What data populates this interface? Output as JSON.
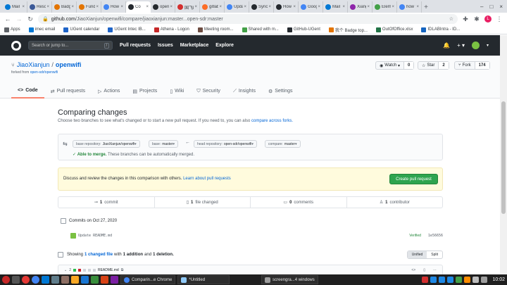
{
  "browser": {
    "tabs": [
      {
        "label": "Mail",
        "color": "#0078d4"
      },
      {
        "label": "Resou",
        "color": "#3b5998"
      },
      {
        "label": "Badge",
        "color": "#e37400"
      },
      {
        "label": "Fundi",
        "color": "#e37400"
      },
      {
        "label": "How t",
        "color": "#4285f4"
      },
      {
        "label": "Co",
        "color": "#24292e",
        "active": true
      },
      {
        "label": "open",
        "color": "#24292e"
      },
      {
        "label": "国飞E",
        "color": "#d32f2f"
      },
      {
        "label": "gitlab",
        "color": "#fc6d26"
      },
      {
        "label": "Upda",
        "color": "#4285f4"
      },
      {
        "label": "Syncii",
        "color": "#24292e"
      },
      {
        "label": "How t",
        "color": "#24292e"
      },
      {
        "label": "Goog",
        "color": "#4285f4"
      },
      {
        "label": "Mail",
        "color": "#0078d4"
      },
      {
        "label": "Xiang",
        "color": "#8e24aa"
      },
      {
        "label": "Eleme",
        "color": "#43a047"
      },
      {
        "label": "how t",
        "color": "#4285f4"
      }
    ],
    "url_host": "github.com",
    "url_path": "/JiaoXianjun/openwifi/compare/jiaoxianjun:master...open-sdr:master",
    "profile_initial": "L",
    "bookmarks": [
      {
        "label": "Apps",
        "color": "#5f6368"
      },
      {
        "label": "imec email",
        "color": "#0078d4"
      },
      {
        "label": "UGent calendar",
        "color": "#1e64c8"
      },
      {
        "label": "UGent Intec IB...",
        "color": "#1e64c8"
      },
      {
        "label": "Athena - Logon",
        "color": "#c62828"
      },
      {
        "label": "Meeting room...",
        "color": "#6d4c41"
      },
      {
        "label": "Shared with m...",
        "color": "#43a047"
      },
      {
        "label": "GitHub-UGent",
        "color": "#24292e"
      },
      {
        "label": "我个 Badge top...",
        "color": "#e37400"
      },
      {
        "label": "OutOfOffice.xlsx",
        "color": "#217346"
      },
      {
        "label": "IDLABIntra - ID...",
        "color": "#1565c0"
      }
    ]
  },
  "github": {
    "search_placeholder": "Search or jump to...",
    "search_key": "/",
    "nav": [
      "Pull requests",
      "Issues",
      "Marketplace",
      "Explore"
    ]
  },
  "repo": {
    "owner": "JiaoXianjun",
    "name": "openwifi",
    "forked_prefix": "forked from",
    "forked_from": "open-sdr/openwifi",
    "watch_label": "Watch",
    "watch_count": "0",
    "star_label": "Star",
    "star_count": "2",
    "fork_label": "Fork",
    "fork_count": "174",
    "tabs": [
      "Code",
      "Pull requests",
      "Actions",
      "Projects",
      "Wiki",
      "Security",
      "Insights",
      "Settings"
    ]
  },
  "compare": {
    "title": "Comparing changes",
    "subtitle": "Choose two branches to see what's changed or to start a new pull request. If you need to, you can also",
    "subtitle_link": "compare across forks.",
    "base_repo_label": "base repository:",
    "base_repo": "JiaoXianjun/openwifi",
    "base_label": "base:",
    "base": "master",
    "head_repo_label": "head repository:",
    "head_repo": "open-sdr/openwifi",
    "compare_label": "compare:",
    "compare": "master",
    "merge_ok": "Able to merge.",
    "merge_msg": "These branches can be automatically merged.",
    "flash_text": "Discuss and review the changes in this comparison with others.",
    "flash_link": "Learn about pull requests",
    "create_pr": "Create pull request",
    "summary": [
      {
        "count": "1",
        "label": "commit"
      },
      {
        "count": "1",
        "label": "file changed"
      },
      {
        "count": "0",
        "label": "comments"
      },
      {
        "count": "1",
        "label": "contributor"
      }
    ],
    "commits_on": "Commits on Oct 27, 2020",
    "commit_message": "Update README.md",
    "verified": "Verified",
    "sha": "1e56656",
    "showing": "Showing",
    "changed_file": "1 changed file",
    "with": "with",
    "additions": "1 addition",
    "and": "and",
    "deletions": "1 deletion.",
    "unified": "Unified",
    "split": "Split",
    "file_changes": "2",
    "file_name": "README.md"
  },
  "taskbar": {
    "window1": "Comparin...e Chrome",
    "window2": "*Untitled",
    "window3": "screengra...4 windows",
    "clock": "10:02"
  }
}
